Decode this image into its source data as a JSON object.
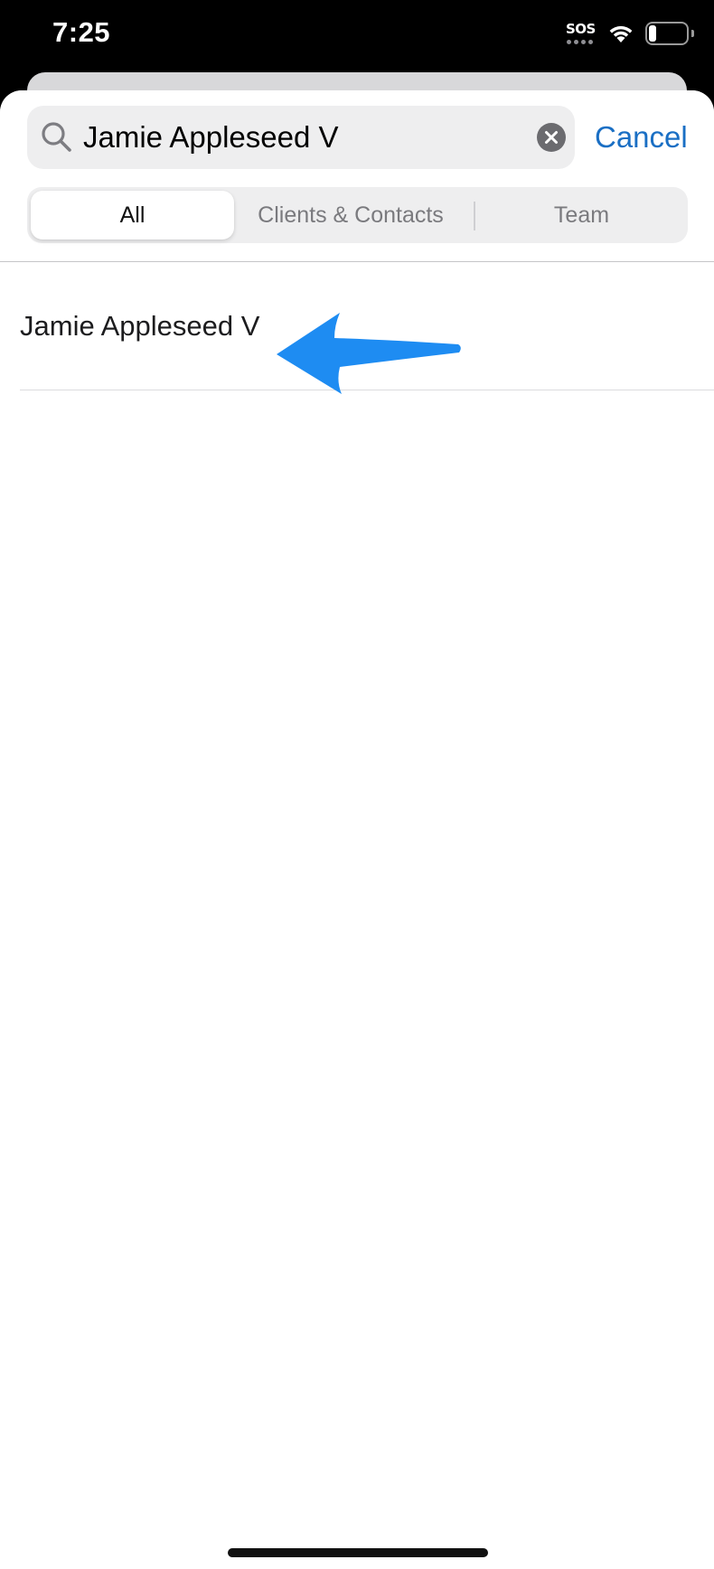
{
  "status_bar": {
    "time": "7:25",
    "sos_label": "SOS",
    "battery_level": 0.2
  },
  "search": {
    "value": "Jamie Appleseed V",
    "cancel_label": "Cancel"
  },
  "segments": [
    {
      "label": "All",
      "selected": true
    },
    {
      "label": "Clients & Contacts",
      "selected": false
    },
    {
      "label": "Team",
      "selected": false
    }
  ],
  "results": [
    {
      "name": "Jamie Appleseed V"
    }
  ],
  "colors": {
    "accent": "#1a6fc4",
    "annotation_arrow": "#1e8cf2"
  },
  "icons": {
    "search": "magnifier-icon",
    "clear": "clear-x-icon",
    "wifi": "wifi-icon",
    "battery": "battery-icon",
    "annotation": "arrow-left-icon"
  }
}
